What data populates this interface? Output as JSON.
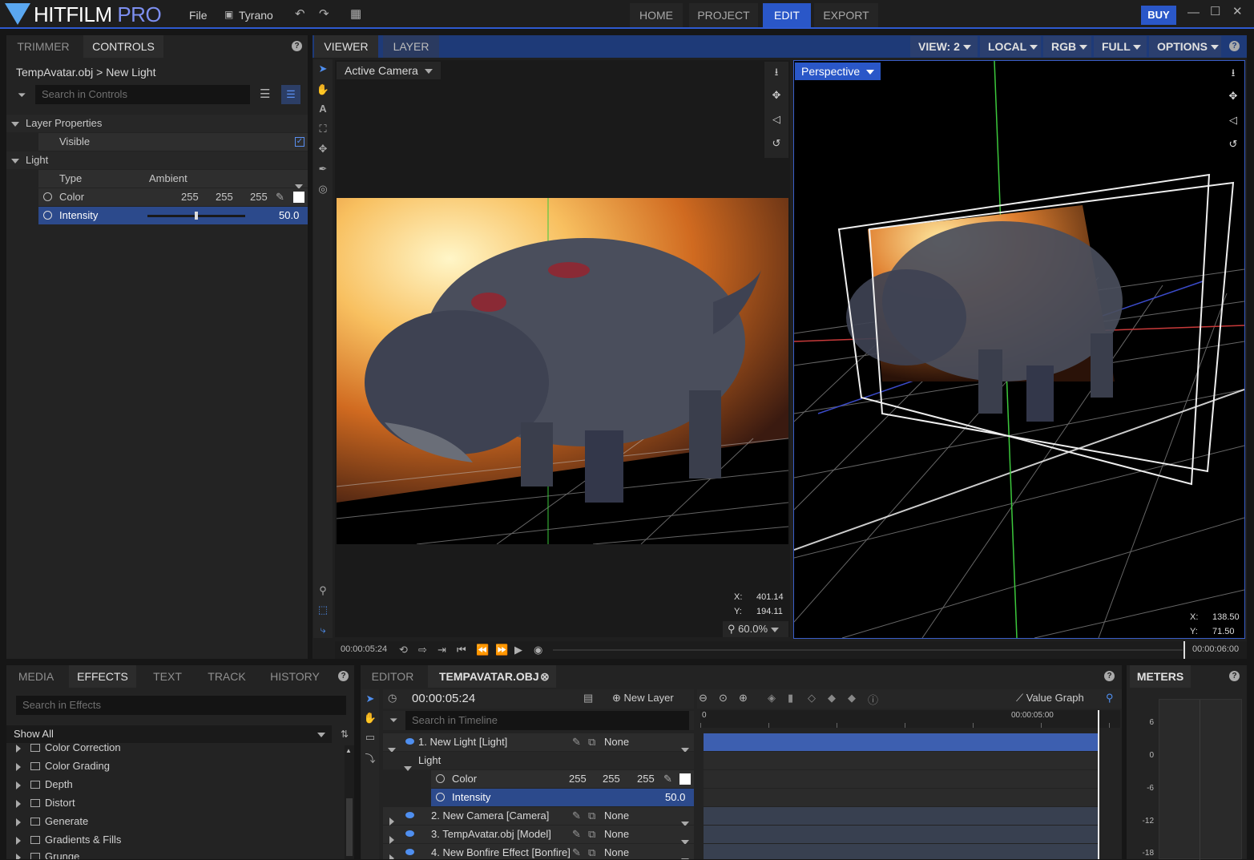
{
  "app": {
    "name_main": "HITFILM",
    "name_sub": "PRO"
  },
  "menu": {
    "file": "File",
    "project_name": "Tyrano"
  },
  "nav": {
    "home": "HOME",
    "project": "PROJECT",
    "edit": "EDIT",
    "export": "EXPORT",
    "buy": "BUY"
  },
  "controls_panel": {
    "tabs": [
      "TRIMMER",
      "CONTROLS"
    ],
    "breadcrumb": "TempAvatar.obj > New Light",
    "search_placeholder": "Search in Controls",
    "layer_properties": "Layer Properties",
    "visible": "Visible",
    "light": "Light",
    "type_label": "Type",
    "type_value": "Ambient",
    "color_label": "Color",
    "color_r": "255",
    "color_g": "255",
    "color_b": "255",
    "intensity_label": "Intensity",
    "intensity_value": "50.0"
  },
  "viewer": {
    "tabs": [
      "VIEWER",
      "LAYER"
    ],
    "options": [
      "VIEW: 2",
      "LOCAL",
      "RGB",
      "FULL",
      "OPTIONS"
    ],
    "left_camera": "Active Camera",
    "right_camera": "Perspective",
    "left_x_label": "X:",
    "left_x": "401.14",
    "left_y_label": "Y:",
    "left_y": "194.11",
    "zoom": "60.0%",
    "right_x_label": "X:",
    "right_x": "138.50",
    "right_y_label": "Y:",
    "right_y": "71.50",
    "time_current": "00:00:05:24",
    "time_end": "00:00:06:00"
  },
  "effects_panel": {
    "tabs": [
      "MEDIA",
      "EFFECTS",
      "TEXT",
      "TRACK",
      "HISTORY"
    ],
    "search_placeholder": "Search in Effects",
    "filter": "Show All",
    "items": [
      "Color Correction",
      "Color Grading",
      "Depth",
      "Distort",
      "Generate",
      "Gradients & Fills",
      "Grunge"
    ]
  },
  "editor_panel": {
    "tabs": [
      "EDITOR",
      "TEMPAVATAR.OBJ"
    ],
    "timecode": "00:00:05:24",
    "new_layer": "New Layer",
    "value_graph": "Value Graph",
    "search_placeholder": "Search in Timeline",
    "ruler_start": "0",
    "ruler_mark": "00:00:05:00",
    "layers": [
      {
        "name": "1. New Light [Light]",
        "parent": "None"
      },
      {
        "name": "2. New Camera [Camera]",
        "parent": "None"
      },
      {
        "name": "3. TempAvatar.obj [Model]",
        "parent": "None"
      },
      {
        "name": "4. New Bonfire Effect [Bonfire]",
        "parent": "None"
      }
    ],
    "sub_light": "Light",
    "sub_color": "Color",
    "color_r": "255",
    "color_g": "255",
    "color_b": "255",
    "sub_intensity": "Intensity",
    "intensity_value": "50.0"
  },
  "meters": {
    "title": "METERS",
    "ticks": [
      "6",
      "0",
      "-6",
      "-12",
      "-18"
    ]
  }
}
